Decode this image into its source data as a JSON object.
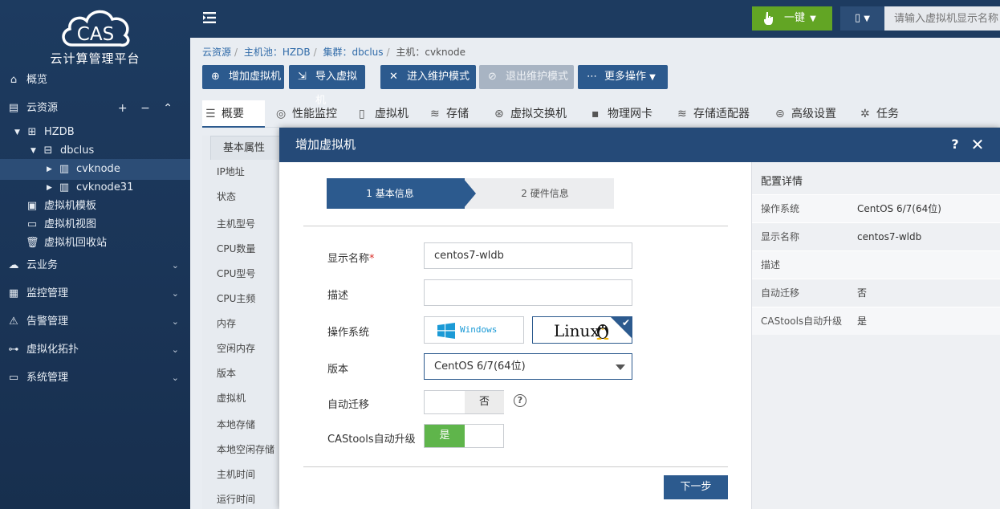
{
  "sidebar": {
    "logo_text": "CAS",
    "subtitle": "云计算管理平台",
    "items": [
      {
        "label": "概览"
      },
      {
        "label": "云资源"
      },
      {
        "label": "HZDB"
      },
      {
        "label": "dbclus"
      },
      {
        "label": "cvknode"
      },
      {
        "label": "cvknode31"
      },
      {
        "label": "虚拟机模板"
      },
      {
        "label": "虚拟机视图"
      },
      {
        "label": "虚拟机回收站"
      },
      {
        "label": "云业务"
      },
      {
        "label": "监控管理"
      },
      {
        "label": "告警管理"
      },
      {
        "label": "虚拟化拓扑"
      },
      {
        "label": "系统管理"
      }
    ]
  },
  "topbar": {
    "yijian_label": "一键",
    "search_placeholder": "请输入虚拟机显示名称"
  },
  "breadcrumb": {
    "p1": "云资源",
    "p2": "主机池：HZDB",
    "p3": "集群：dbclus",
    "p4": "主机：cvknode"
  },
  "toolbar": {
    "add_vm": "增加虚拟机",
    "import_vm": "导入虚拟机",
    "enter_maint": "进入维护模式",
    "exit_maint": "退出维护模式",
    "more": "更多操作"
  },
  "tabs": [
    "概要",
    "性能监控",
    "虚拟机",
    "存储",
    "虚拟交换机",
    "物理网卡",
    "存储适配器",
    "高级设置",
    "任务"
  ],
  "leftpanel": {
    "header": "基本属性",
    "rows": [
      "IP地址",
      "状态",
      "主机型号",
      "CPU数量",
      "CPU型号",
      "CPU主频",
      "内存",
      "空闲内存",
      "版本",
      "虚拟机",
      "本地存储",
      "本地空闲存储",
      "主机时间",
      "运行时间"
    ]
  },
  "dialog": {
    "title": "增加虚拟机",
    "help": "?",
    "close": "✕",
    "step1": "1 基本信息",
    "step2": "2 硬件信息",
    "fields": {
      "display_name_label": "显示名称",
      "required_mark": "*",
      "display_name_value": "centos7-wldb",
      "desc_label": "描述",
      "desc_value": "",
      "os_label": "操作系统",
      "os_windows": "Windows",
      "os_linux": "Linux",
      "version_label": "版本",
      "version_value": "CentOS 6/7(64位)",
      "auto_migrate_label": "自动迁移",
      "auto_migrate_value": "否",
      "castools_label": "CAStools自动升级",
      "castools_value": "是"
    },
    "next": "下一步",
    "detail": {
      "title": "配置详情",
      "rows": [
        {
          "k": "操作系统",
          "v": "CentOS 6/7(64位)"
        },
        {
          "k": "显示名称",
          "v": "centos7-wldb"
        },
        {
          "k": "描述",
          "v": ""
        },
        {
          "k": "自动迁移",
          "v": "否"
        },
        {
          "k": "CAStools自动升级",
          "v": "是"
        }
      ]
    }
  },
  "colors": {
    "sidebar_bg": "#1d3b60",
    "primary": "#2c5a8e",
    "green": "#62a524",
    "toggle_on": "#5fb54b"
  }
}
